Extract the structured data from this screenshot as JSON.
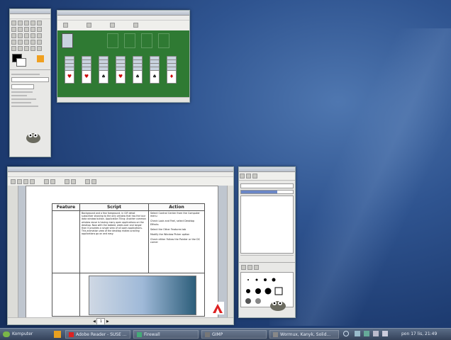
{
  "desktop": {
    "background_accent": "#2f5490"
  },
  "taskbar": {
    "start_label": "Komputer",
    "tasks": [
      {
        "label": "Adobe Reader - SUSE ..."
      },
      {
        "label": "Firewall"
      },
      {
        "label": "GIMP"
      },
      {
        "label": "Wormux, Kanyk, Solid..."
      }
    ],
    "clock": "pon 17 lis, 21:49"
  },
  "doc_window": {
    "page_number": "1",
    "table": {
      "headers": [
        "Feature",
        "Script",
        "Action"
      ],
      "script_text": "Background and a few foreground, in GIF detail subscriber showing to the only window that has the tour data window button. Application Tiling: Another common window reuse is having many open applications on the desktop. Now with the tabbed, week-over and longer than it provides a single view of all open applications. This animation view of the desktop makes scrolling applications go on and easy.",
      "action_items": [
        "Select Control Center from the Computer menu",
        "Check Look and Feel, select Desktop Effects",
        "Select the Other Features tab",
        "Modify the Window Picker option",
        "Check either Follow the Pointer or the DC corner"
      ]
    }
  }
}
